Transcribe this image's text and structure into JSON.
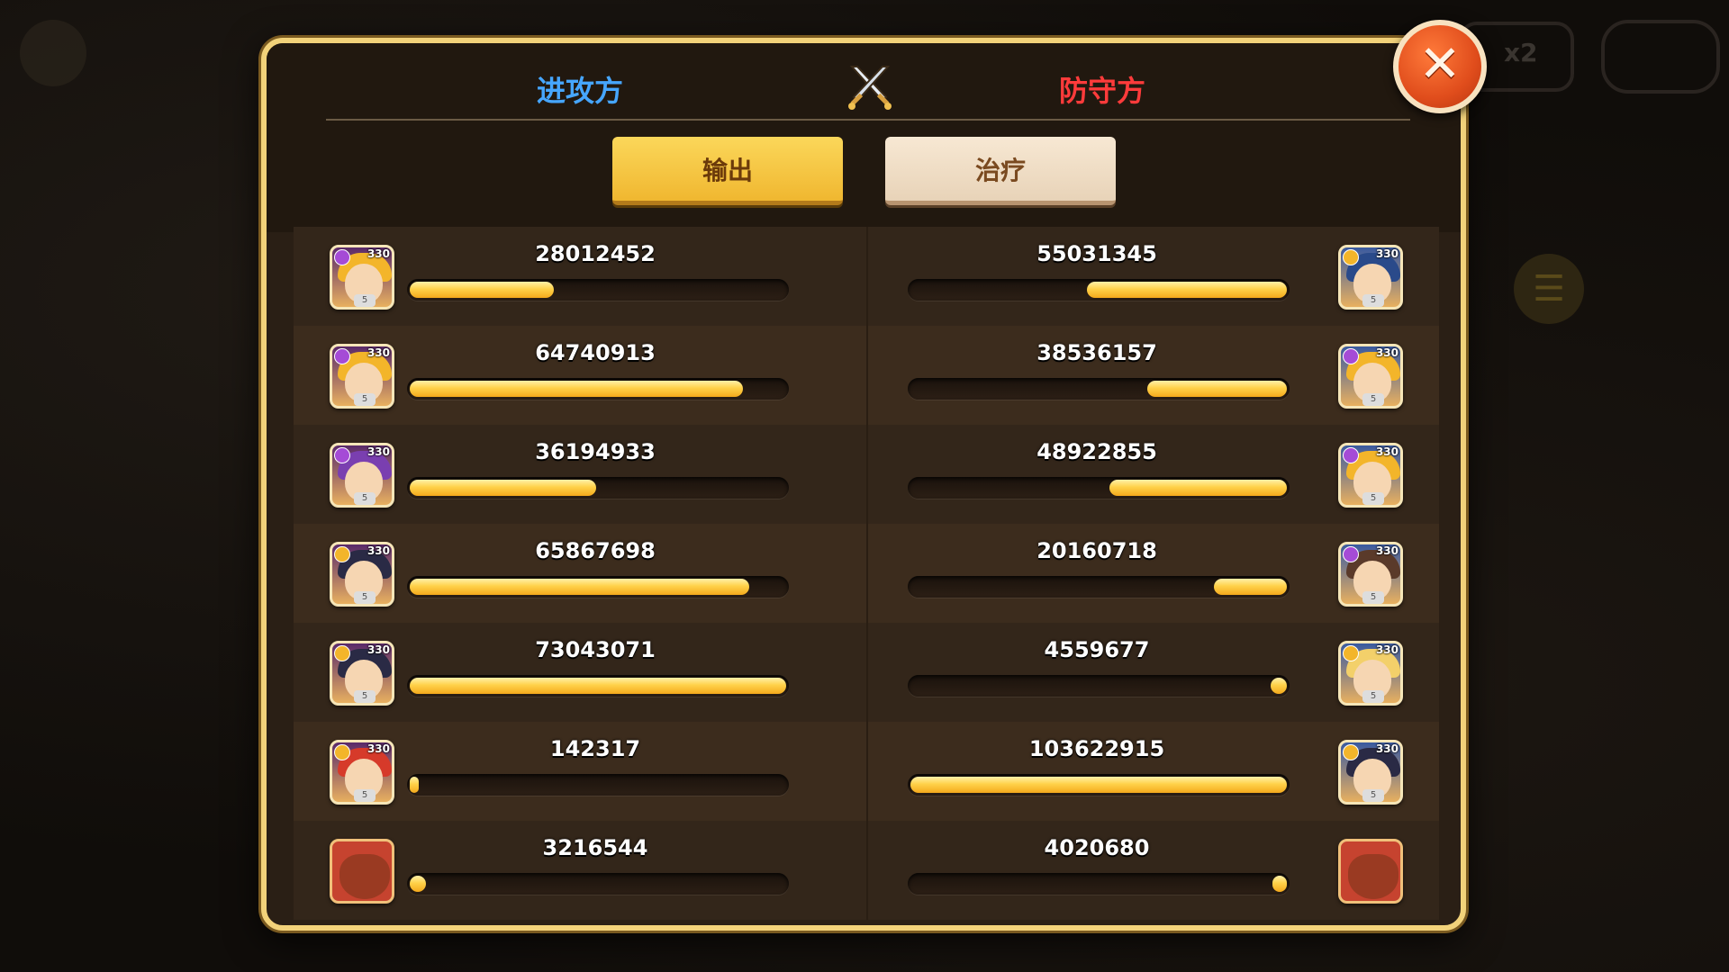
{
  "header": {
    "attacker_label": "进攻方",
    "defender_label": "防守方"
  },
  "tabs": {
    "output_label": "输出",
    "heal_label": "治疗"
  },
  "close_icon": "close-icon",
  "swords_icon": "crossed-swords-icon",
  "background": {
    "speed_label": "x2"
  },
  "rows": [
    {
      "left": {
        "value": "28012452",
        "level": "330",
        "element": "purple"
      },
      "right": {
        "value": "55031345",
        "level": "330",
        "element": "gold"
      }
    },
    {
      "left": {
        "value": "64740913",
        "level": "330",
        "element": "purple"
      },
      "right": {
        "value": "38536157",
        "level": "330",
        "element": "purple"
      }
    },
    {
      "left": {
        "value": "36194933",
        "level": "330",
        "element": "purple"
      },
      "right": {
        "value": "48922855",
        "level": "330",
        "element": "purple"
      }
    },
    {
      "left": {
        "value": "65867698",
        "level": "330",
        "element": "gold"
      },
      "right": {
        "value": "20160718",
        "level": "330",
        "element": "purple"
      }
    },
    {
      "left": {
        "value": "73043071",
        "level": "330",
        "element": "gold"
      },
      "right": {
        "value": "4559677",
        "level": "330",
        "element": "gold"
      }
    },
    {
      "left": {
        "value": "142317",
        "level": "330",
        "element": "gold"
      },
      "right": {
        "value": "103622915",
        "level": "330",
        "element": "gold"
      }
    },
    {
      "left": {
        "value": "3216544",
        "level": "",
        "element": "boss"
      },
      "right": {
        "value": "4020680",
        "level": "",
        "element": "boss"
      }
    }
  ],
  "colors": {
    "attacker": "#46a6ff",
    "defender": "#ff3b3b",
    "bar_fill": "#ffd24a",
    "tab_active": "#f0b730"
  }
}
